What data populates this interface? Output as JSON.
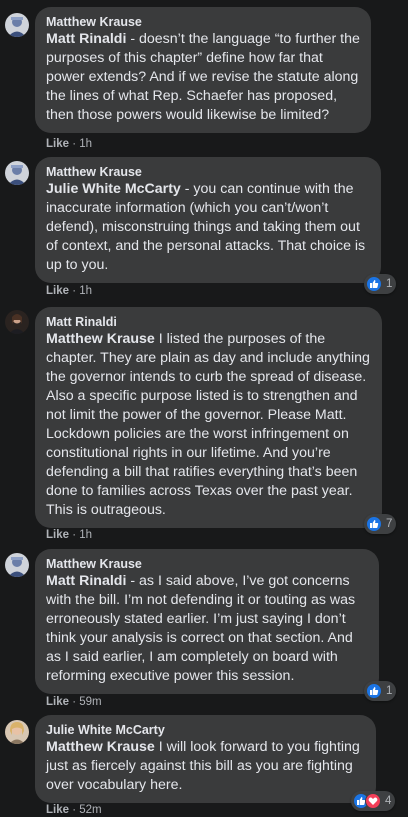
{
  "comments": [
    {
      "author": "Matthew Krause",
      "mention": "Matt Rinaldi",
      "text": " - doesn’t the language “to further the purposes of this chapter” define how far that power extends? And if we revise the statute along the lines of what Rep. Schaefer has proposed, then those powers would likewise be limited?",
      "like_label": "Like",
      "time": "1h",
      "reaction_count": ""
    },
    {
      "author": "Matthew Krause",
      "mention": "Julie White McCarty",
      "text": " - you can continue with the inaccurate information (which you can’t/won’t defend), misconstruing things and taking them out of context, and the personal attacks. That choice is up to you.",
      "like_label": "Like",
      "time": "1h",
      "reaction_count": "1"
    },
    {
      "author": "Matt Rinaldi",
      "mention": "Matthew Krause",
      "text": " I listed the purposes of the chapter. They are plain as day and include anything the governor intends to curb the spread of disease. Also a specific purpose listed is to strengthen and not limit the power of the governor. Please Matt. Lockdown policies are the worst infringement on constitutional rights in our lifetime. And you’re defending a bill that ratifies everything that’s been done to families across Texas over the past year. This is outrageous.",
      "like_label": "Like",
      "time": "1h",
      "reaction_count": "7"
    },
    {
      "author": "Matthew Krause",
      "mention": "Matt Rinaldi",
      "text": " - as I said above, I’ve got concerns with the bill. I’m not defending it or touting as was erroneously stated earlier. I’m just saying I don’t think your analysis is correct on that section. And as I said earlier, I am completely on board with reforming executive power this session.",
      "like_label": "Like",
      "time": "59m",
      "reaction_count": "1"
    },
    {
      "author": "Julie White McCarty",
      "mention": "Matthew Krause",
      "text": " I will look forward to you fighting just as fiercely against this bill as you are fighting over vocabulary here.",
      "like_label": "Like",
      "time": "52m",
      "reaction_count": "4"
    }
  ],
  "separator": " · ",
  "colors": {
    "background": "#18191a",
    "bubble": "#3a3b3c",
    "text": "#e4e6eb",
    "meta": "#b0b3b8",
    "like_blue": "#1b74e4",
    "love_red": "#f33e58"
  },
  "icons": {
    "like": "thumbs-up-icon",
    "love": "heart-icon"
  }
}
